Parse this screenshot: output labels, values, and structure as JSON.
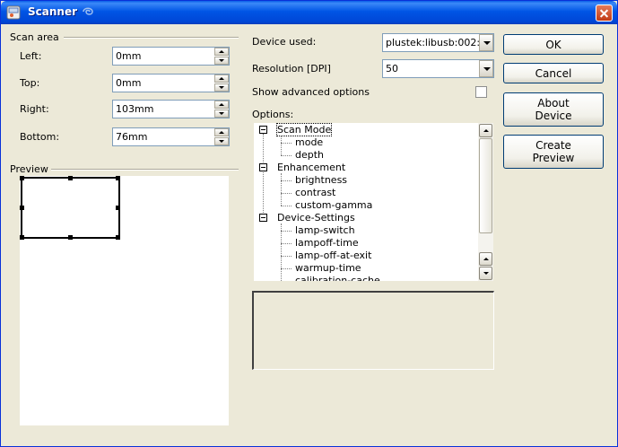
{
  "window": {
    "title": "Scanner"
  },
  "scan_area": {
    "group_label": "Scan area",
    "left": {
      "label": "Left:",
      "value": "0mm"
    },
    "top": {
      "label": "Top:",
      "value": "0mm"
    },
    "right": {
      "label": "Right:",
      "value": "103mm"
    },
    "bottom": {
      "label": "Bottom:",
      "value": "76mm"
    }
  },
  "preview": {
    "group_label": "Preview"
  },
  "device": {
    "label": "Device used:",
    "value": "plustek:libusb:002:"
  },
  "resolution": {
    "label": "Resolution [DPI]",
    "value": "50"
  },
  "advanced": {
    "label": "Show advanced options",
    "checked": false
  },
  "options": {
    "label": "Options:",
    "tree": {
      "scan_mode": "Scan Mode",
      "mode": "mode",
      "depth": "depth",
      "enhancement": "Enhancement",
      "brightness": "brightness",
      "contrast": "contrast",
      "custom_gamma": "custom-gamma",
      "device_settings": "Device-Settings",
      "lamp_switch": "lamp-switch",
      "lampoff_time": "lampoff-time",
      "lamp_off_at_exit": "lamp-off-at-exit",
      "warmup_time": "warmup-time",
      "calibration_cache": "calibration-cache"
    }
  },
  "buttons": {
    "ok": "OK",
    "cancel": "Cancel",
    "about_line1": "About",
    "about_line2": "Device",
    "create_line1": "Create",
    "create_line2": "Preview"
  },
  "icons": {
    "app": "scanner-app-icon",
    "sticky": "sticky-icon",
    "close": "close-icon"
  }
}
